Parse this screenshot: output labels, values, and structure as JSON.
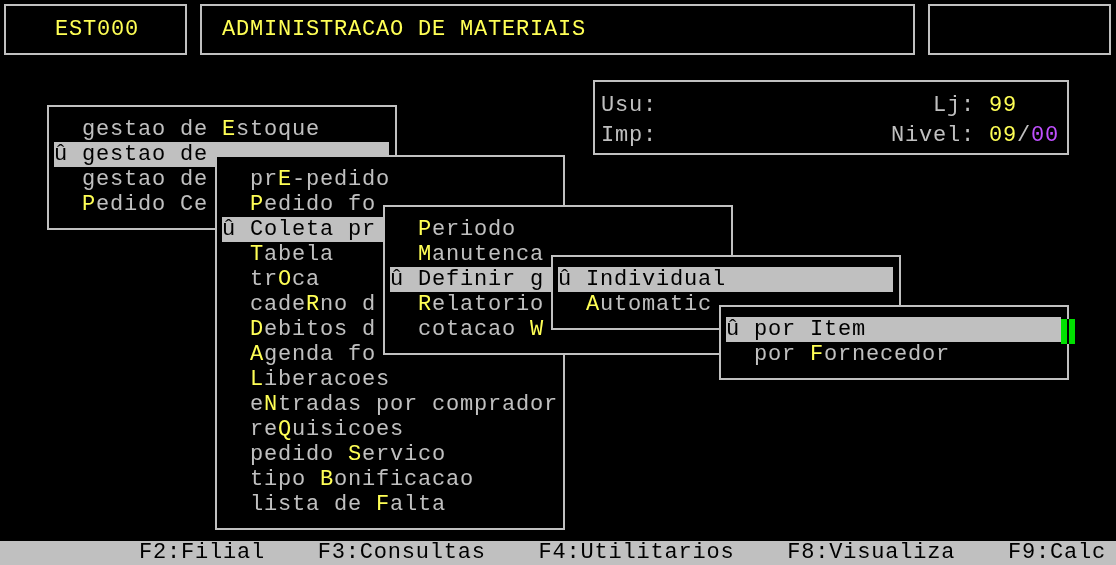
{
  "header": {
    "code": "EST000",
    "title": "ADMINISTRACAO DE MATERIAIS"
  },
  "info": {
    "user_label": "Usu:",
    "store_label": "Lj:",
    "store": "99",
    "printer_label": "Imp:",
    "nivel_label": "Nivel:",
    "nivel": "09",
    "separator": "/",
    "nivel_max": "00"
  },
  "windows": [
    {
      "cursor": false,
      "items": [
        {
          "text": "gestao de ",
          "key": "E",
          "rest": "stoque",
          "selected": false
        },
        {
          "marker": "û",
          "text": "gestao de",
          "selected": true
        },
        {
          "text": "gestao de",
          "selected": false
        },
        {
          "key": "P",
          "rest": "edido Ce",
          "selected": false
        }
      ]
    },
    {
      "cursor": false,
      "items": [
        {
          "text": "pr",
          "key": "E",
          "rest": "-pedido",
          "selected": false
        },
        {
          "key": "P",
          "rest": "edido fo",
          "selected": false
        },
        {
          "marker": "û",
          "text": "Coleta pr",
          "selected": true
        },
        {
          "key": "T",
          "rest": "abela",
          "selected": false
        },
        {
          "text": "tr",
          "key": "O",
          "rest": "ca",
          "selected": false
        },
        {
          "text": "cade",
          "key": "R",
          "rest": "no d",
          "selected": false
        },
        {
          "key": "D",
          "rest": "ebitos d",
          "selected": false
        },
        {
          "key": "A",
          "rest": "genda fo",
          "selected": false
        },
        {
          "key": "L",
          "rest": "iberacoes",
          "selected": false
        },
        {
          "text": "e",
          "key": "N",
          "rest": "tradas por comprador",
          "selected": false
        },
        {
          "text": "re",
          "key": "Q",
          "rest": "uisicoes",
          "selected": false
        },
        {
          "text": "pedido ",
          "key": "S",
          "rest": "ervico",
          "selected": false
        },
        {
          "text": "tipo ",
          "key": "B",
          "rest": "onificacao",
          "selected": false
        },
        {
          "text": "lista de ",
          "key": "F",
          "rest": "alta",
          "selected": false
        }
      ]
    },
    {
      "cursor": false,
      "items": [
        {
          "key": "P",
          "rest": "eriodo",
          "selected": false
        },
        {
          "key": "M",
          "rest": "anutenca",
          "selected": false
        },
        {
          "marker": "û",
          "text": "Definir g",
          "selected": true
        },
        {
          "key": "R",
          "rest": "elatorio",
          "selected": false
        },
        {
          "text": "cotacao ",
          "key": "W",
          "selected": false
        }
      ]
    },
    {
      "cursor": false,
      "items": [
        {
          "marker": "û",
          "text": "Individual",
          "selected": true
        },
        {
          "key": "A",
          "rest": "utomatic",
          "selected": false
        }
      ]
    },
    {
      "cursor": true,
      "items": [
        {
          "marker": "û",
          "text": "por Item",
          "selected": true
        },
        {
          "text": "por ",
          "key": "F",
          "rest": "ornecedor",
          "selected": false
        }
      ]
    }
  ],
  "function_keys": [
    "F2:Filial",
    "F3:Consultas",
    "F4:Utilitarios",
    "F8:Visualiza",
    "F9:Calc"
  ]
}
